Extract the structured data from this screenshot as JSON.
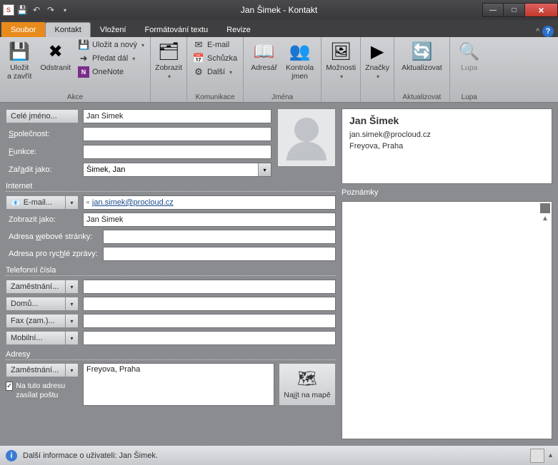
{
  "window": {
    "title": "Jan Šimek - Kontakt"
  },
  "tabs": {
    "file": "Soubor",
    "contact": "Kontakt",
    "insert": "Vložení",
    "format": "Formátování textu",
    "review": "Revize"
  },
  "ribbon": {
    "save_close": "Uložit\na zavřít",
    "delete": "Odstranit",
    "save_new": "Uložit a nový",
    "forward": "Předat dál",
    "onenote": "OneNote",
    "group_actions": "Akce",
    "show": "Zobrazit",
    "email_btn": "E-mail",
    "meeting": "Schůzka",
    "more": "Další",
    "group_comm": "Komunikace",
    "addrbook": "Adresář",
    "checknames": "Kontrola\njmen",
    "group_names": "Jména",
    "options": "Možnosti",
    "tags": "Značky",
    "update": "Aktualizovat",
    "group_update": "Aktualizovat",
    "zoom": "Lupa",
    "group_zoom": "Lupa"
  },
  "form": {
    "fullname_btn": "Celé jméno...",
    "fullname_val": "Jan Šimek",
    "company_lbl": "Společnost:",
    "jobtitle_lbl": "Funkce:",
    "fileas_lbl": "Zařadit jako:",
    "fileas_val": "Šimek, Jan",
    "section_internet": "Internet",
    "email_btn": "E-mail...",
    "email_val": "jan.simek@procloud.cz",
    "displayas_lbl": "Zobrazit jako:",
    "displayas_val": "Jan Šimek",
    "web_lbl": "Adresa webové stránky:",
    "im_lbl": "Adresa pro rychlé zprávy:",
    "section_phones": "Telefonní čísla",
    "phone1": "Zaměstnání...",
    "phone2": "Domů...",
    "phone3": "Fax (zam.)...",
    "phone4": "Mobilní...",
    "section_addr": "Adresy",
    "addr_btn": "Zaměstnání...",
    "addr_val": "Freyova, Praha",
    "mailing_chk": "Na tuto adresu zasílat poštu",
    "map_btn": "Najít na mapě"
  },
  "card": {
    "name": "Jan Šimek",
    "email": "jan.simek@procloud.cz",
    "addr": "Freyova, Praha"
  },
  "notes_hdr": "Poznámky",
  "status": {
    "text": "Další informace o uživateli: Jan Šimek."
  }
}
